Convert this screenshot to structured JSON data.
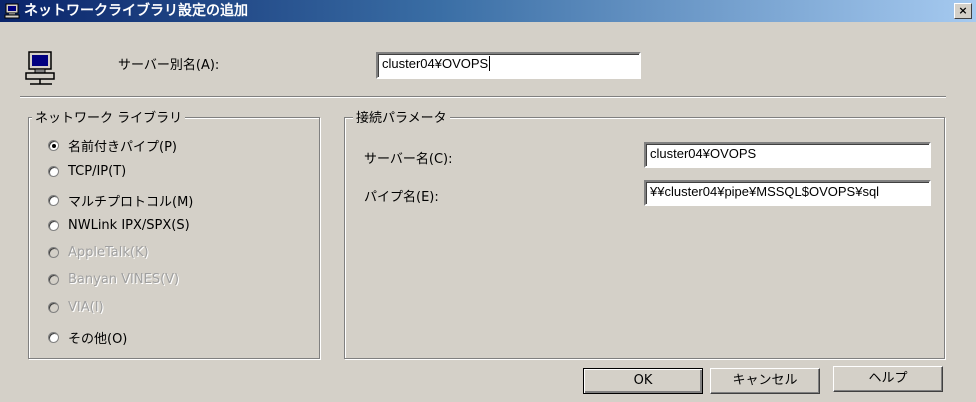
{
  "window": {
    "title": "ネットワークライブラリ設定の追加",
    "close_label": "×",
    "icon": "server-computer-icon"
  },
  "alias": {
    "label": "サーバー別名(A):",
    "value": "cluster04¥OVOPS"
  },
  "network_library": {
    "title": "ネットワーク ライブラリ",
    "options": [
      {
        "label": "名前付きパイプ(P)",
        "checked": true,
        "enabled": true
      },
      {
        "label": "TCP/IP(T)",
        "checked": false,
        "enabled": true
      },
      {
        "label": "マルチプロトコル(M)",
        "checked": false,
        "enabled": true
      },
      {
        "label": "NWLink IPX/SPX(S)",
        "checked": false,
        "enabled": true
      },
      {
        "label": "AppleTalk(K)",
        "checked": false,
        "enabled": false
      },
      {
        "label": "Banyan VINES(V)",
        "checked": false,
        "enabled": false
      },
      {
        "label": "VIA(I)",
        "checked": false,
        "enabled": false
      },
      {
        "label": "その他(O)",
        "checked": false,
        "enabled": true
      }
    ]
  },
  "connection": {
    "title": "接続パラメータ",
    "server_name_label": "サーバー名(C):",
    "server_name_value": "cluster04¥OVOPS",
    "pipe_name_label": "パイプ名(E):",
    "pipe_name_value": "¥¥cluster04¥pipe¥MSSQL$OVOPS¥sql"
  },
  "buttons": {
    "ok": "OK",
    "cancel": "キャンセル",
    "help": "ヘルプ"
  }
}
